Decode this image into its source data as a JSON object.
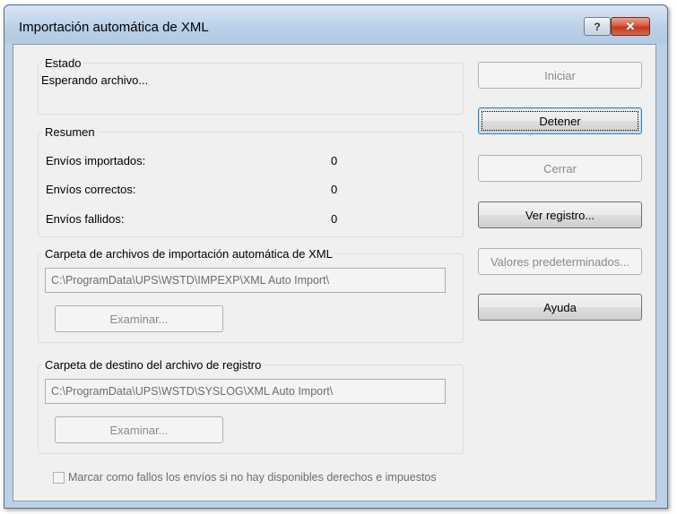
{
  "window": {
    "title": "Importación automática de XML",
    "help_label": "?",
    "close_label": "✕"
  },
  "estado": {
    "label": "Estado",
    "status": "Esperando archivo..."
  },
  "resumen": {
    "label": "Resumen",
    "rows": [
      {
        "label": "Envíos importados:",
        "value": "0"
      },
      {
        "label": "Envíos correctos:",
        "value": "0"
      },
      {
        "label": "Envíos fallidos:",
        "value": "0"
      }
    ]
  },
  "import_folder": {
    "label": "Carpeta de archivos de importación automática de XML",
    "path": "C:\\ProgramData\\UPS\\WSTD\\IMPEXP\\XML Auto Import\\",
    "browse_label": "Examinar..."
  },
  "log_folder": {
    "label": "Carpeta de destino del archivo de registro",
    "path": "C:\\ProgramData\\UPS\\WSTD\\SYSLOG\\XML Auto Import\\",
    "browse_label": "Examinar..."
  },
  "checkbox": {
    "label": "Marcar como fallos los envíos si no hay disponibles derechos e impuestos",
    "checked": false
  },
  "buttons": {
    "iniciar": "Iniciar",
    "detener": "Detener",
    "cerrar": "Cerrar",
    "ver_registro": "Ver registro...",
    "valores": "Valores predeterminados...",
    "ayuda": "Ayuda"
  }
}
